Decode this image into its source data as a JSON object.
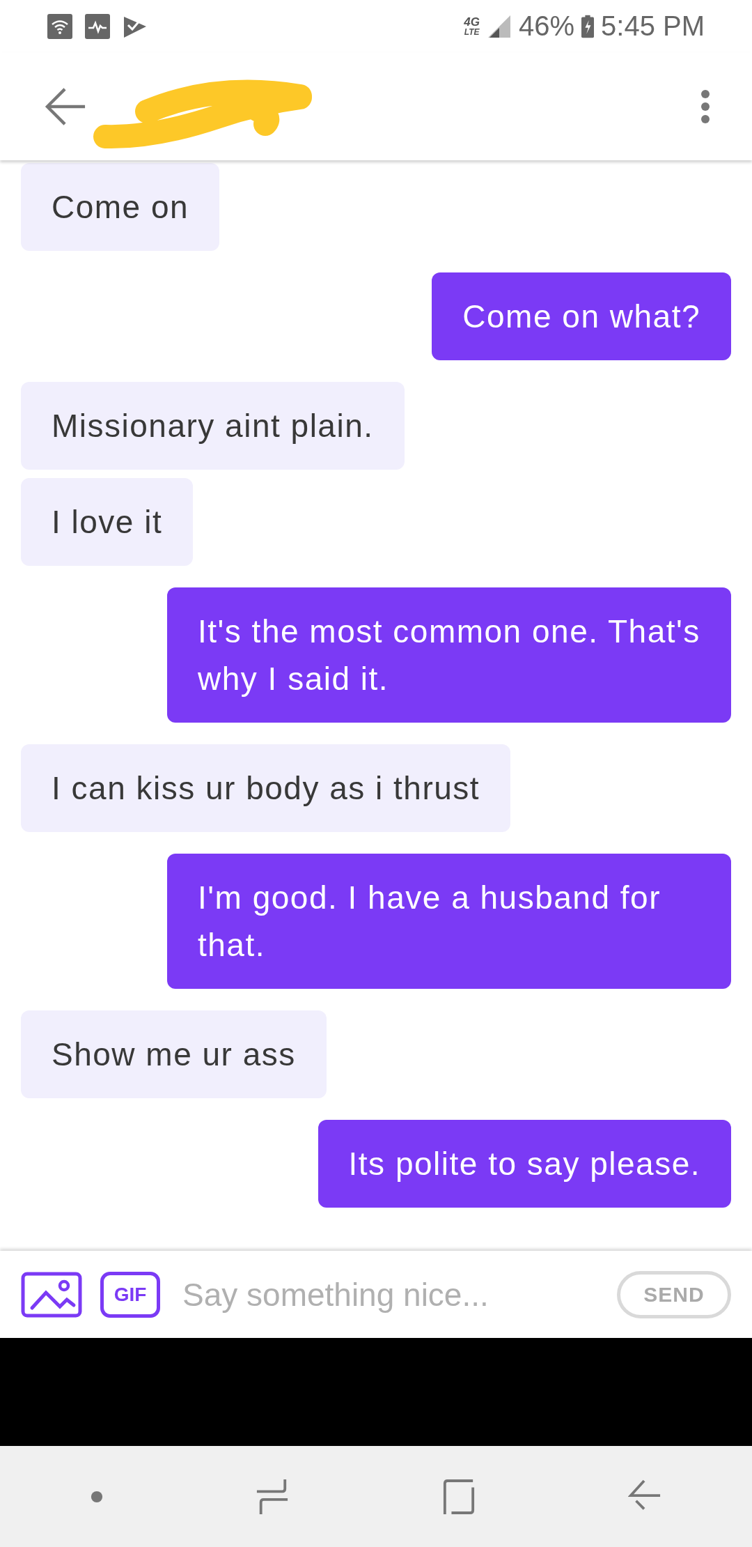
{
  "status_bar": {
    "network_type": "4G",
    "network_sub": "LTE",
    "battery": "46%",
    "time": "5:45 PM"
  },
  "header": {
    "name_redacted": true
  },
  "messages": [
    {
      "kind": "received",
      "text": "Come on"
    },
    {
      "kind": "sent",
      "text": "Come on what?"
    },
    {
      "kind": "received",
      "text": "Missionary aint plain."
    },
    {
      "kind": "received",
      "text": "I love it"
    },
    {
      "kind": "sent",
      "text": "It's the most common one. That's why I said it."
    },
    {
      "kind": "received",
      "text": "I can kiss ur body as i thrust"
    },
    {
      "kind": "sent",
      "text": "I'm good. I have a husband for that."
    },
    {
      "kind": "received",
      "text": "Show me ur ass"
    },
    {
      "kind": "sent",
      "text": "Its polite to say please."
    }
  ],
  "composer": {
    "gif": "GIF",
    "placeholder": "Say something nice...",
    "send": "SEND",
    "send_disabled": true
  }
}
